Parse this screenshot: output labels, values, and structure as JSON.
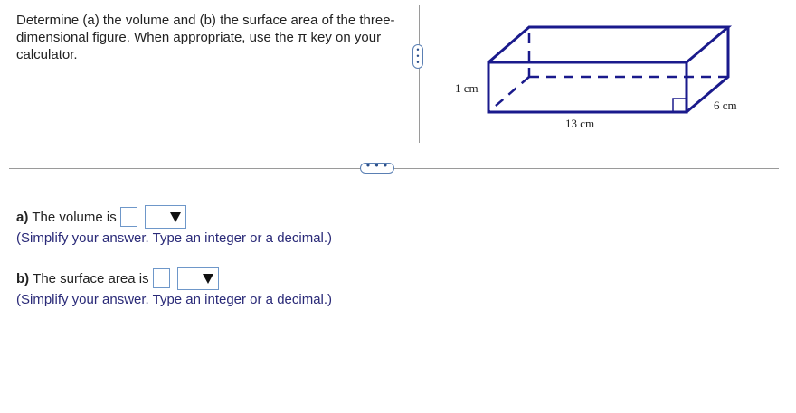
{
  "question": {
    "text": "Determine (a) the volume and (b) the surface area of the three-dimensional figure. When appropriate, use the π key on your calculator."
  },
  "figure": {
    "height_label": "1 cm",
    "length_label": "13 cm",
    "width_label": "6 cm",
    "line_color": "#1a1a8c"
  },
  "splitter_vertical": {
    "glyph": "⋮"
  },
  "splitter_horizontal": {
    "glyph": "···"
  },
  "part_a": {
    "prefix": "a)",
    "text": "The volume is",
    "input_value": "",
    "unit_select_value": "",
    "hint": "(Simplify your answer. Type an integer or a decimal.)"
  },
  "part_b": {
    "prefix": "b)",
    "text": "The surface area is",
    "input_value": "",
    "unit_select_value": "",
    "hint": "(Simplify your answer. Type an integer or a decimal.)"
  }
}
